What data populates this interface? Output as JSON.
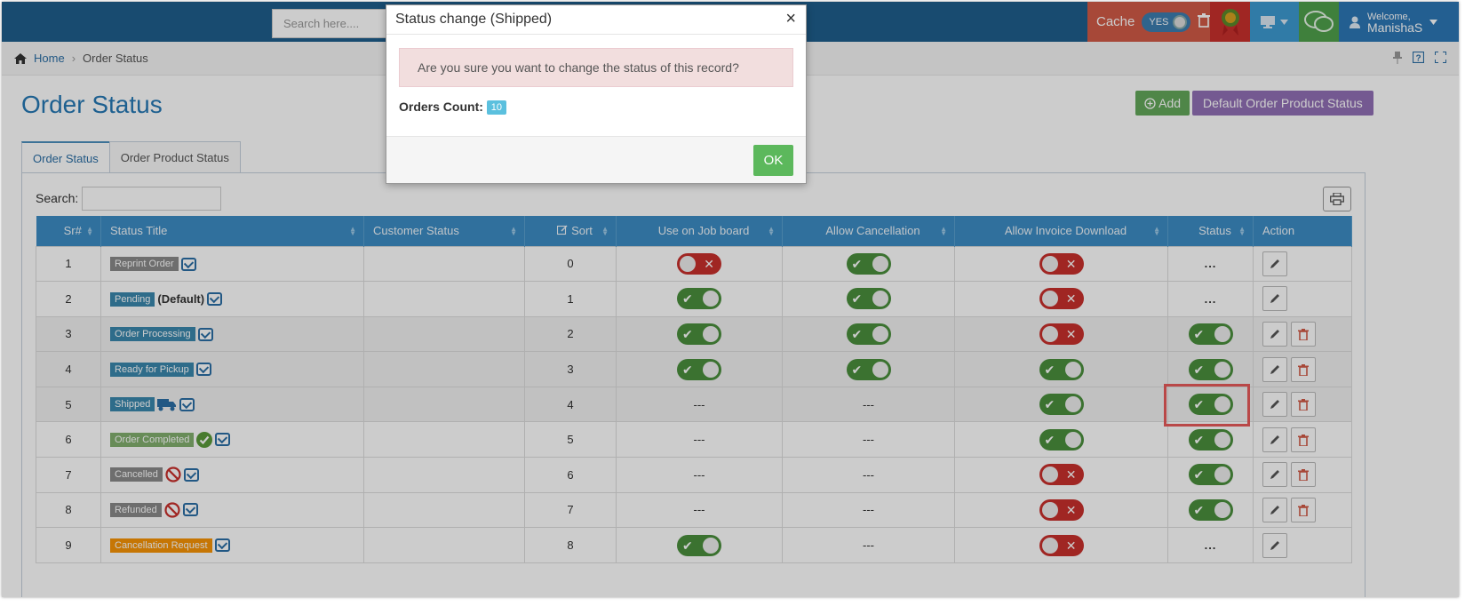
{
  "navbar": {
    "search_placeholder": "Search here....",
    "cache_label": "Cache",
    "cache_toggle_label": "YES",
    "welcome_small": "Welcome,",
    "user_name": "ManishaS"
  },
  "breadcrumb": {
    "home": "Home",
    "separator": "›",
    "current": "Order Status"
  },
  "page": {
    "title": "Order Status",
    "add_button": "Add",
    "default_button": "Default Order Product Status",
    "tabs": [
      {
        "label": "Order Status",
        "active": true
      },
      {
        "label": "Order Product Status",
        "active": false
      }
    ],
    "search_label": "Search:"
  },
  "table": {
    "headers": [
      "Sr#",
      "Status Title",
      "Customer Status",
      "Sort",
      "Use on Job board",
      "Allow Cancellation",
      "Allow Invoice Download",
      "Status",
      "Action"
    ],
    "rows": [
      {
        "sr": "1",
        "title": "Reprint Order",
        "tag_color": "gray",
        "extra": "",
        "icon": "",
        "sort": "0",
        "job": "off",
        "cancel": "on",
        "invoice": "off",
        "status": "...",
        "delete": false
      },
      {
        "sr": "2",
        "title": "Pending",
        "tag_color": "blue",
        "extra": "(Default)",
        "icon": "",
        "sort": "1",
        "job": "on",
        "cancel": "on",
        "invoice": "off",
        "status": "...",
        "delete": false
      },
      {
        "sr": "3",
        "title": "Order Processing",
        "tag_color": "blue",
        "extra": "",
        "icon": "",
        "sort": "2",
        "job": "on",
        "cancel": "on",
        "invoice": "off",
        "status": "on",
        "delete": true
      },
      {
        "sr": "4",
        "title": "Ready for Pickup",
        "tag_color": "blue",
        "extra": "",
        "icon": "",
        "sort": "3",
        "job": "on",
        "cancel": "on",
        "invoice": "on",
        "status": "on",
        "delete": true
      },
      {
        "sr": "5",
        "title": "Shipped",
        "tag_color": "blue",
        "extra": "",
        "icon": "truck",
        "sort": "4",
        "job": "---",
        "cancel": "---",
        "invoice": "on",
        "status": "on",
        "delete": true
      },
      {
        "sr": "6",
        "title": "Order Completed",
        "tag_color": "green",
        "extra": "",
        "icon": "check",
        "sort": "5",
        "job": "---",
        "cancel": "---",
        "invoice": "on",
        "status": "on",
        "delete": true
      },
      {
        "sr": "7",
        "title": "Cancelled",
        "tag_color": "gray",
        "extra": "",
        "icon": "ban",
        "sort": "6",
        "job": "---",
        "cancel": "---",
        "invoice": "off",
        "status": "on",
        "delete": true
      },
      {
        "sr": "8",
        "title": "Refunded",
        "tag_color": "gray",
        "extra": "",
        "icon": "ban",
        "sort": "7",
        "job": "---",
        "cancel": "---",
        "invoice": "off",
        "status": "on",
        "delete": true
      },
      {
        "sr": "9",
        "title": "Cancellation Request",
        "tag_color": "orange",
        "extra": "",
        "icon": "",
        "sort": "8",
        "job": "on",
        "cancel": "---",
        "invoice": "off",
        "status": "...",
        "delete": false
      }
    ]
  },
  "modal": {
    "title": "Status change (Shipped)",
    "close": "×",
    "message": "Are you sure you want to change the status of this record?",
    "count_label": "Orders Count:",
    "count_value": "10",
    "ok_button": "OK"
  }
}
